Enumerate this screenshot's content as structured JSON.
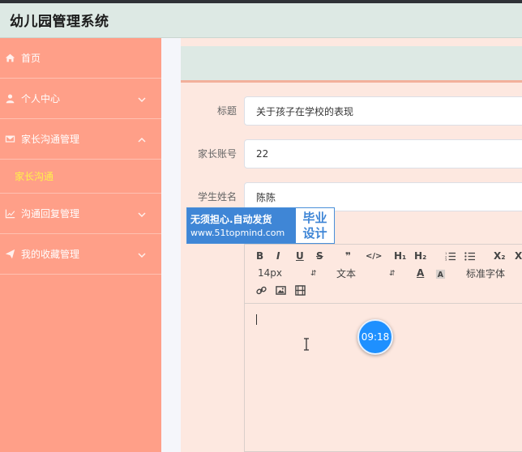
{
  "header": {
    "title": "幼儿园管理系统"
  },
  "sidebar": {
    "items": [
      {
        "label": "首页",
        "icon": "home-icon"
      },
      {
        "label": "个人中心",
        "icon": "user-icon"
      },
      {
        "label": "家长沟通管理",
        "icon": "mail-icon"
      },
      {
        "label": "沟通回复管理",
        "icon": "chart-icon"
      },
      {
        "label": "我的收藏管理",
        "icon": "send-icon"
      }
    ],
    "submenu": {
      "label": "家长沟通"
    }
  },
  "form": {
    "title_label": "标题",
    "title_value": "关于孩子在学校的表现",
    "account_label": "家长账号",
    "account_value": "22",
    "student_label": "学生姓名",
    "student_value": "陈陈"
  },
  "editor": {
    "font_size": "14px",
    "text_type": "文本",
    "font_family": "标准字体",
    "h1": "H₁",
    "h2": "H₂",
    "sub": "X₂",
    "bold": "B",
    "italic": "I",
    "underline": "U",
    "strike": "S",
    "quote": "❞",
    "code": "</>",
    "clear": "X"
  },
  "overlay": {
    "time": "09:18",
    "watermark_line1": "无须担心.自动发货",
    "watermark_line2": "www.51topmind.com",
    "watermark_right1": "毕业",
    "watermark_right2": "设计"
  },
  "colors": {
    "sidebar": "#ff9f88",
    "header": "#dde9e4",
    "panel": "#fde8e0",
    "submenu_active": "#fff14a",
    "clock": "#1e90ff"
  }
}
